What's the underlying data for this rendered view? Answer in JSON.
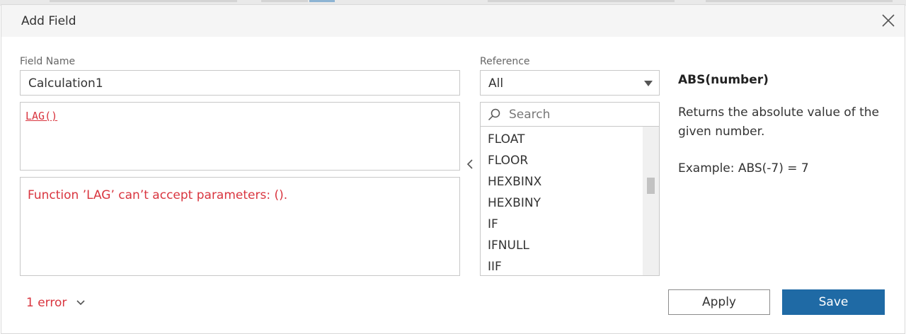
{
  "dialog": {
    "title": "Add Field"
  },
  "field_name": {
    "label": "Field Name",
    "value": "Calculation1"
  },
  "editor": {
    "code": "LAG()"
  },
  "error_panel": {
    "message": "Function ’LAG’ can’t accept parameters: ()."
  },
  "reference": {
    "label": "Reference",
    "selected": "All",
    "search_placeholder": "Search",
    "functions": [
      "FLOAT",
      "FLOOR",
      "HEXBINX",
      "HEXBINY",
      "IF",
      "IFNULL",
      "IIF"
    ]
  },
  "help": {
    "title": "ABS(number)",
    "description": "Returns the absolute value of the given number.",
    "example": "Example: ABS(-7) = 7"
  },
  "footer": {
    "error_count": "1 error",
    "apply_label": "Apply",
    "save_label": "Save"
  },
  "colors": {
    "accent": "#1f6aa5",
    "error": "#d9353f",
    "header_bg": "#f5f5f5"
  },
  "icons": {
    "close": "close-icon",
    "dropdown": "dropdown-arrow-icon",
    "search": "search-icon",
    "collapse": "chevron-left-icon",
    "error_toggle": "chevron-down-icon"
  }
}
